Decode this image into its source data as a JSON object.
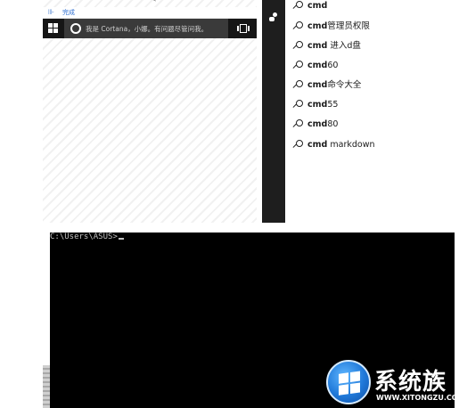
{
  "taskbar": {
    "status_text": "完成",
    "search_placeholder": "我是 Cortana，小娜。有问题尽管问我。"
  },
  "suggestions": [
    {
      "bold": "cmd",
      "rest": ""
    },
    {
      "bold": "cmd",
      "rest": "管理员权限"
    },
    {
      "bold": "cmd",
      "rest": " 进入d盘"
    },
    {
      "bold": "cmd",
      "rest": "60"
    },
    {
      "bold": "cmd",
      "rest": "命令大全"
    },
    {
      "bold": "cmd",
      "rest": "55"
    },
    {
      "bold": "cmd",
      "rest": "80"
    },
    {
      "bold": "cmd",
      "rest": " markdown"
    }
  ],
  "cmd": {
    "prompt": "C:\\Users\\ASUS>"
  },
  "watermark": {
    "name_cn": "系统族",
    "name_en": "WWW.XITONGZU.COM"
  },
  "icons": {
    "start": "windows-logo-icon",
    "cortana": "cortana-circle-icon",
    "task_view": "task-view-icon",
    "user": "user-icon",
    "search": "magnifier-icon"
  },
  "colors": {
    "taskbar": "#161616",
    "search_box": "#3a3a3a",
    "console": "#000000",
    "logo_blue": "#1f78d8"
  }
}
